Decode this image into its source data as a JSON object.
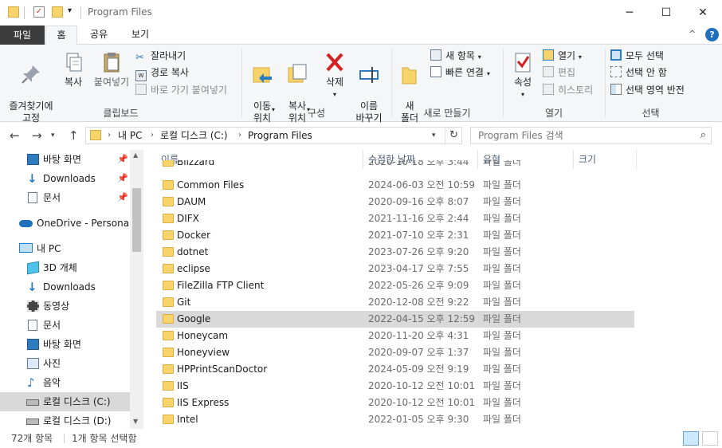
{
  "window": {
    "title": "Program Files",
    "minimize": "─",
    "maximize": "☐",
    "close": "✕"
  },
  "tabs": {
    "file": "파일",
    "home": "홈",
    "share": "공유",
    "view": "보기"
  },
  "ribbon": {
    "clipboard": {
      "pin": "즐겨찾기에\n고정",
      "copy": "복사",
      "paste": "붙여넣기",
      "cut": "잘라내기",
      "copy_path": "경로 복사",
      "paste_shortcut": "바로 가기 붙여넣기",
      "label": "클립보드"
    },
    "organize": {
      "move": "이동\n위치",
      "copy_to": "복사\n위치",
      "delete": "삭제",
      "rename": "이름\n바꾸기",
      "label": "구성"
    },
    "new": {
      "folder": "새\n폴더",
      "new_item": "새 항목",
      "easy_access": "빠른 연결",
      "label": "새로 만들기"
    },
    "open": {
      "properties": "속성",
      "open": "열기",
      "edit": "편집",
      "history": "히스토리",
      "label": "열기"
    },
    "select": {
      "all": "모두 선택",
      "none": "선택 안 함",
      "invert": "선택 영역 반전",
      "label": "선택"
    }
  },
  "address": {
    "crumbs": [
      "내 PC",
      "로컬 디스크 (C:)",
      "Program Files"
    ],
    "search_placeholder": "Program Files 검색"
  },
  "nav": {
    "quick": [
      {
        "label": "바탕 화면",
        "icon": "desktop-icon"
      },
      {
        "label": "Downloads",
        "icon": "download-icon"
      },
      {
        "label": "문서",
        "icon": "document-icon"
      }
    ],
    "onedrive": "OneDrive - Personal",
    "thispc": "내 PC",
    "pc_items": [
      {
        "label": "3D 개체",
        "icon": "3d-objects-icon"
      },
      {
        "label": "Downloads",
        "icon": "download-icon"
      },
      {
        "label": "동영상",
        "icon": "video-icon"
      },
      {
        "label": "문서",
        "icon": "document-icon"
      },
      {
        "label": "바탕 화면",
        "icon": "desktop-icon"
      },
      {
        "label": "사진",
        "icon": "pictures-icon"
      },
      {
        "label": "음악",
        "icon": "music-icon"
      },
      {
        "label": "로컬 디스크 (C:)",
        "icon": "drive-icon"
      },
      {
        "label": "로컬 디스크 (D:)",
        "icon": "drive-icon"
      }
    ]
  },
  "columns": {
    "name": "이름",
    "modified": "수정한 날짜",
    "type": "유형",
    "size": "크기"
  },
  "partial_row": {
    "name": "Blizzard",
    "date": "2020-10-18 오후 3:44",
    "type": "파일 폴더"
  },
  "rows": [
    {
      "name": "Common Files",
      "date": "2024-06-03 오전 10:59",
      "type": "파일 폴더"
    },
    {
      "name": "DAUM",
      "date": "2020-09-16 오후 8:07",
      "type": "파일 폴더"
    },
    {
      "name": "DIFX",
      "date": "2021-11-16 오후 2:44",
      "type": "파일 폴더"
    },
    {
      "name": "Docker",
      "date": "2021-07-10 오후 2:31",
      "type": "파일 폴더"
    },
    {
      "name": "dotnet",
      "date": "2023-07-26 오후 9:20",
      "type": "파일 폴더"
    },
    {
      "name": "eclipse",
      "date": "2023-04-17 오후 7:55",
      "type": "파일 폴더"
    },
    {
      "name": "FileZilla FTP Client",
      "date": "2022-05-26 오후 9:09",
      "type": "파일 폴더"
    },
    {
      "name": "Git",
      "date": "2020-12-08 오전 9:22",
      "type": "파일 폴더"
    },
    {
      "name": "Google",
      "date": "2022-04-15 오후 12:59",
      "type": "파일 폴더"
    },
    {
      "name": "Honeycam",
      "date": "2020-11-20 오후 4:31",
      "type": "파일 폴더"
    },
    {
      "name": "Honeyview",
      "date": "2020-09-07 오후 1:37",
      "type": "파일 폴더"
    },
    {
      "name": "HPPrintScanDoctor",
      "date": "2024-05-09 오전 9:19",
      "type": "파일 폴더"
    },
    {
      "name": "IIS",
      "date": "2020-10-12 오전 10:01",
      "type": "파일 폴더"
    },
    {
      "name": "IIS Express",
      "date": "2020-10-12 오전 10:01",
      "type": "파일 폴더"
    },
    {
      "name": "Intel",
      "date": "2022-01-05 오후 9:30",
      "type": "파일 폴더"
    }
  ],
  "status": {
    "count": "72개 항목",
    "selected": "1개 항목 선택함"
  }
}
